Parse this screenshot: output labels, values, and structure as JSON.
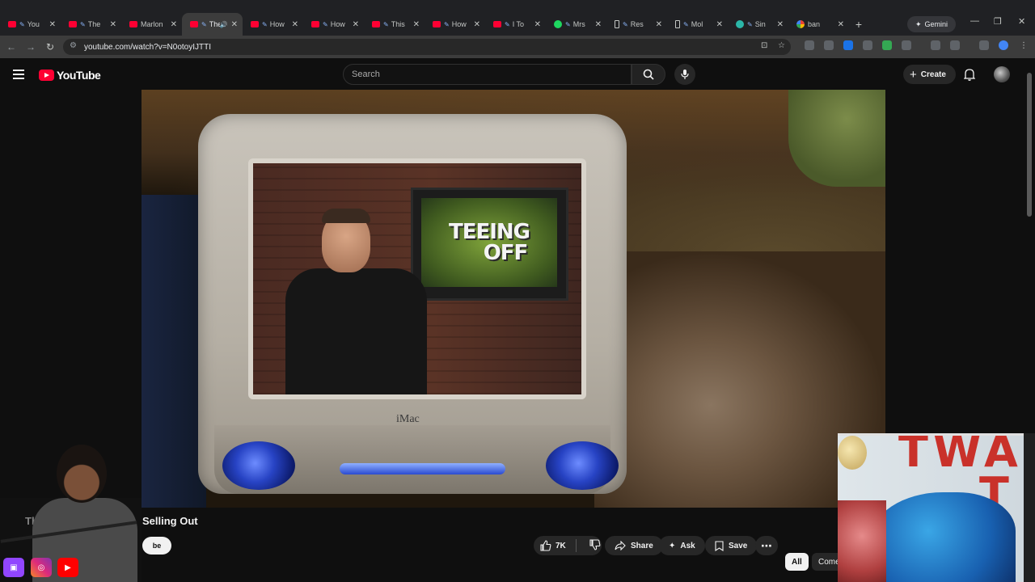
{
  "browser": {
    "tabs": [
      {
        "title": "You",
        "fav": "yt"
      },
      {
        "title": "The",
        "fav": "yt"
      },
      {
        "title": "Marlon",
        "fav": "yt"
      },
      {
        "title": "The",
        "fav": "yt",
        "active": true
      },
      {
        "title": "How",
        "fav": "yt"
      },
      {
        "title": "How",
        "fav": "yt"
      },
      {
        "title": "This",
        "fav": "yt"
      },
      {
        "title": "How",
        "fav": "yt"
      },
      {
        "title": "I To",
        "fav": "yt"
      },
      {
        "title": "Mrs",
        "fav": "spot"
      },
      {
        "title": "Res",
        "fav": "phone"
      },
      {
        "title": "Mol",
        "fav": "phone"
      },
      {
        "title": "Sin",
        "fav": "sin"
      },
      {
        "title": "ban",
        "fav": "g"
      }
    ],
    "new_tab_symbol": "+",
    "gemini_label": "Gemini",
    "url": "youtube.com/watch?v=N0otoyIJTTI"
  },
  "youtube": {
    "logo_text": "YouTube",
    "search_placeholder": "Search",
    "create_label": "Create"
  },
  "video": {
    "screen_text_line1": "TEEING",
    "screen_text_line2": "OFF",
    "imac_brand": "iMac"
  },
  "info": {
    "title_left": "The",
    "title_right": "Selling Out",
    "subscribe_fragment": "be",
    "like_count": "7K",
    "share_label": "Share",
    "ask_label": "Ask",
    "save_label": "Save",
    "filters": [
      "All",
      "Come"
    ]
  },
  "overlay": {
    "stream_letters_line1": "TWA",
    "stream_letters_line2": "T"
  },
  "colors": {
    "brand_red": "#ff0033",
    "background": "#0f0f0f",
    "pill": "#272727"
  }
}
